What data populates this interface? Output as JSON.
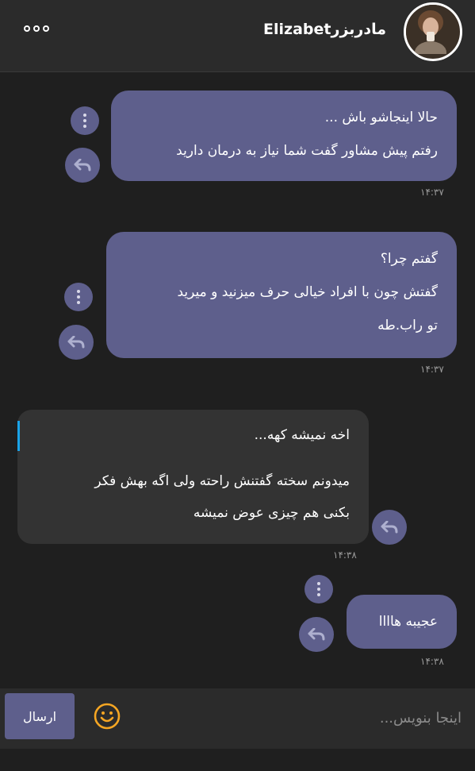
{
  "header": {
    "contact_name": "مادربزرElizabet"
  },
  "messages": [
    {
      "lines": [
        "حالا اینجاشو باش ...",
        "رفتم پیش مشاور گفت شما نیاز به درمان دارید"
      ],
      "time": "۱۴:۳۷",
      "direction": "outgoing"
    },
    {
      "lines": [
        "گفتم چرا؟",
        "گفتش چون با افراد خیالی حرف میزنید و میرید",
        "تو راب.طه"
      ],
      "time": "۱۴:۳۷",
      "direction": "outgoing"
    },
    {
      "lines": [
        "اخه نمیشه کهه...",
        "میدونم سخته گفتنش راحته ولی اگه بهش فکر",
        "بکنی هم چیزی عوض نمیشه"
      ],
      "time": "۱۴:۳۸",
      "direction": "incoming"
    },
    {
      "lines": [
        "عجیبه هاااا"
      ],
      "time": "۱۴:۳۸",
      "direction": "outgoing"
    }
  ],
  "composer": {
    "placeholder": "اینجا بنویس...",
    "send_label": "ارسال"
  },
  "icons": {
    "menu": "more-horizontal-icon",
    "avatar": "profile-photo",
    "message_menu": "kebab-icon",
    "reply": "reply-icon",
    "emoji": "smiley-icon"
  },
  "colors": {
    "bubble": "#5e5f8c",
    "incoming_bubble": "#333333",
    "background": "#1f1f1f",
    "emoji": "#f5a623",
    "quote_bar": "#1aa3e8"
  }
}
